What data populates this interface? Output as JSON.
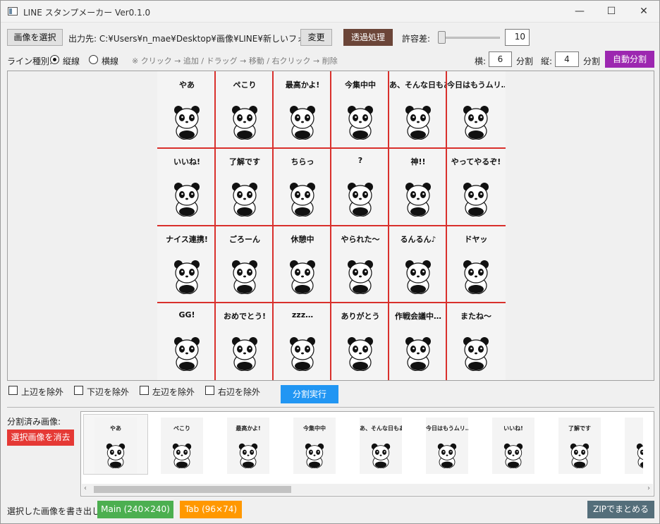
{
  "window": {
    "title": "LINE スタンプメーカー Ver0.1.0",
    "minimize": "—",
    "maximize": "☐",
    "close": "✕"
  },
  "toolbar": {
    "select_image": "画像を選択",
    "output_prefix": "出力先: C:¥Users¥n_mae¥Desktop¥画像¥LINE¥新しいフォルダー",
    "change": "変更",
    "transparency": "透過処理",
    "tolerance_label": "許容差:",
    "tolerance_value": "10",
    "tolerance_level": 0.05
  },
  "line_row": {
    "line_type_label": "ライン種別:",
    "vertical": "縦線",
    "horizontal": "横線",
    "hint": "※ クリック → 追加 / ドラッグ → 移動 / 右クリック → 削除",
    "cols_label": "横:",
    "cols_value": "6",
    "cols_unit": "分割",
    "rows_label": "縦:",
    "rows_value": "4",
    "rows_unit": "分割",
    "auto_split": "自動分割"
  },
  "stamps": [
    [
      "やあ",
      "ペこり",
      "最高かよ!",
      "今集中中",
      "あ、そんな日もある",
      "今日はもうムリ…"
    ],
    [
      "いいね!",
      "了解です",
      "ちらっ",
      "?",
      "神!!",
      "やってやるぞ!"
    ],
    [
      "ナイス連携!",
      "ごろーん",
      "休憩中",
      "やられた〜",
      "るんるん♪",
      "ドヤッ"
    ],
    [
      "GG!",
      "おめでとう!",
      "zzz…",
      "ありがとう",
      "作戦会議中…",
      "またね〜"
    ]
  ],
  "exclude": {
    "top": "上辺を除外",
    "bottom": "下辺を除外",
    "left": "左辺を除外",
    "right": "右辺を除外"
  },
  "split_run": "分割実行",
  "split_images_label": "分割済み画像:",
  "delete_selected": "選択画像を消去",
  "thumbnails": [
    "やあ",
    "ペこり",
    "最高かよ!",
    "今集中中",
    "あ、そんな日もある",
    "今日はもうムリ…",
    "いいね!",
    "了解です",
    ""
  ],
  "export": {
    "label": "選択した画像を書き出し:",
    "main": "Main (240×240)",
    "tab": "Tab (96×74)",
    "zip": "ZIPでまとめる"
  },
  "colors": {
    "transparency": "#6b4538",
    "auto_split": "#9c27b0",
    "split_run": "#2196f3",
    "delete": "#e53935",
    "main": "#4caf50",
    "tab": "#ff9800",
    "zip": "#546e7a",
    "grid_line": "#d9302c"
  }
}
